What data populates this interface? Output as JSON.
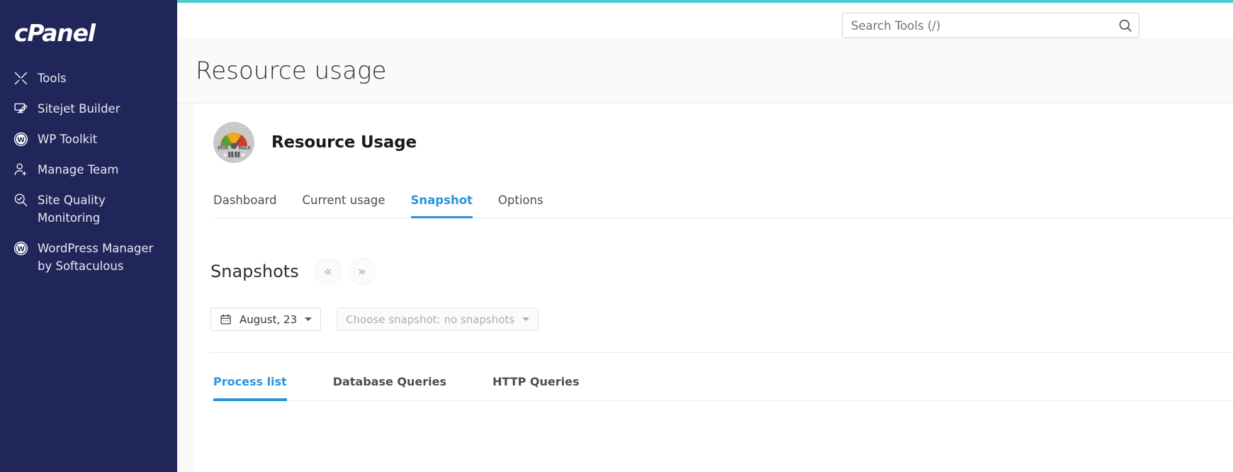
{
  "colors": {
    "sidebar_bg": "#21265a",
    "accent_teal": "#4ec8d3",
    "active_blue": "#2b93e0",
    "page_bg": "#fafafa",
    "gauge_green": "#5f9c35",
    "gauge_orange": "#f0a81e",
    "gauge_red": "#d63c2a"
  },
  "sidebar": {
    "logo": "cPanel",
    "items": [
      {
        "label": "Tools",
        "icon": "tools-icon"
      },
      {
        "label": "Sitejet Builder",
        "icon": "monitor-pen-icon"
      },
      {
        "label": "WP Toolkit",
        "icon": "wordpress-icon"
      },
      {
        "label": "Manage Team",
        "icon": "user-plus-icon"
      },
      {
        "label": "Site Quality Monitoring",
        "icon": "magnifier-check-icon"
      },
      {
        "label": "WordPress Manager by Softaculous",
        "icon": "wordpress-icon"
      }
    ]
  },
  "search": {
    "placeholder": "Search Tools (/)",
    "value": "",
    "icon": "search-icon"
  },
  "page": {
    "title": "Resource usage"
  },
  "card": {
    "icon": "gauge-icon",
    "gauge_min_label": "MIN",
    "gauge_max_label": "MAX",
    "title": "Resource Usage",
    "tabs": [
      {
        "label": "Dashboard",
        "active": false
      },
      {
        "label": "Current usage",
        "active": false
      },
      {
        "label": "Snapshot",
        "active": true
      },
      {
        "label": "Options",
        "active": false
      }
    ]
  },
  "snapshots": {
    "heading": "Snapshots",
    "prev_button": "«",
    "next_button": "»",
    "prev_icon": "double-chevron-left-icon",
    "next_icon": "double-chevron-right-icon",
    "date_picker": {
      "icon": "calendar-icon",
      "value": "August, 23"
    },
    "snapshot_select": {
      "value": "Choose snapshot: no snapshots",
      "disabled": true
    },
    "subtabs": [
      {
        "label": "Process list",
        "active": true
      },
      {
        "label": "Database Queries",
        "active": false
      },
      {
        "label": "HTTP Queries",
        "active": false
      }
    ]
  }
}
